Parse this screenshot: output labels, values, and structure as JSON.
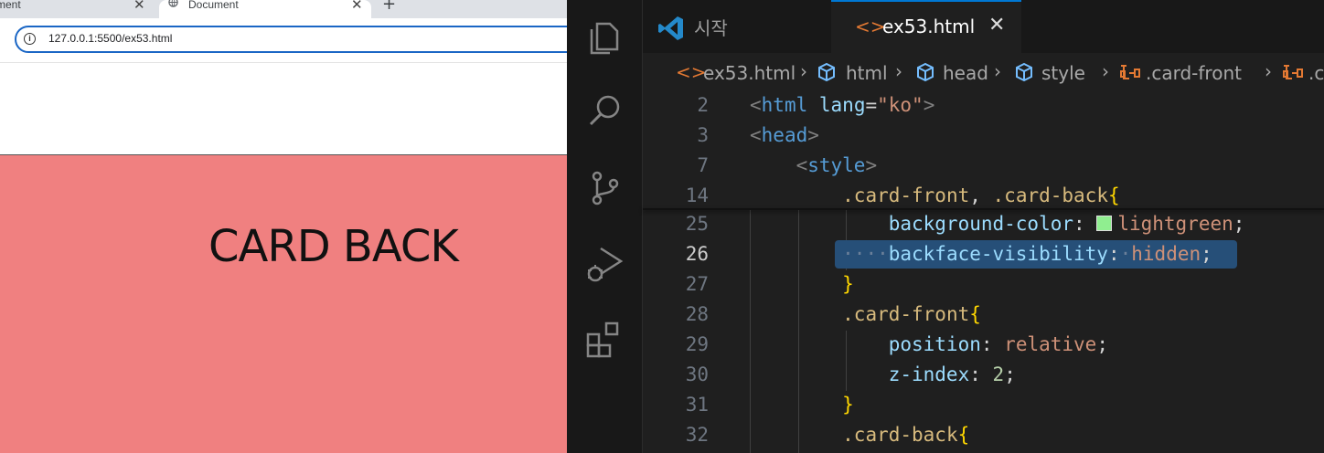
{
  "browser": {
    "tabs": [
      {
        "label": "ment",
        "active": false
      },
      {
        "label": "Document",
        "active": true
      }
    ],
    "new_tab_symbol": "+",
    "close_symbol": "✕",
    "url": "127.0.0.1:5500/ex53.html",
    "info_symbol": "i",
    "page": {
      "card_text": "CARD BACK",
      "card_color": "#f08080"
    }
  },
  "editor": {
    "tabs": [
      {
        "label": "시작",
        "icon": "vscode-logo-icon",
        "active": false
      },
      {
        "label": "ex53.html",
        "icon": "html-code-icon",
        "active": true,
        "close": "✕"
      }
    ],
    "breadcrumbs": {
      "file": "ex53.html",
      "items": [
        "html",
        "head",
        "style",
        ".card-front",
        ".card"
      ]
    },
    "active_line": "26",
    "lines": [
      {
        "n": "2",
        "parts": [
          [
            "c-tag",
            "<"
          ],
          [
            "c-name",
            "html"
          ],
          [
            "c-punc",
            " "
          ],
          [
            "c-attr",
            "lang"
          ],
          [
            "c-eq",
            "="
          ],
          [
            "c-str",
            "\"ko\""
          ],
          [
            "c-tag",
            ">"
          ]
        ],
        "indent": 0
      },
      {
        "n": "3",
        "parts": [
          [
            "c-tag",
            "<"
          ],
          [
            "c-name",
            "head"
          ],
          [
            "c-tag",
            ">"
          ]
        ],
        "indent": 0
      },
      {
        "n": "7",
        "parts": [
          [
            "c-punc",
            "    "
          ],
          [
            "c-tag",
            "<"
          ],
          [
            "c-name",
            "style"
          ],
          [
            "c-tag",
            ">"
          ]
        ],
        "indent": 0
      },
      {
        "n": "14",
        "parts": [
          [
            "c-punc",
            "        "
          ],
          [
            "c-sel",
            ".card-front"
          ],
          [
            "c-punc",
            ", "
          ],
          [
            "c-sel",
            ".card-back"
          ],
          [
            "c-brace",
            "{"
          ]
        ],
        "indent": 0
      },
      {
        "n": "25",
        "parts": [
          [
            "c-punc",
            "            "
          ],
          [
            "c-prop",
            "background-color"
          ],
          [
            "c-punc",
            ": "
          ],
          [
            "swatch",
            ""
          ],
          [
            "c-val",
            "lightgreen"
          ],
          [
            "c-punc",
            ";"
          ]
        ],
        "indent": 0
      },
      {
        "n": "26",
        "parts": [
          [
            "c-punc",
            "        "
          ],
          [
            "c-dot",
            "····"
          ],
          [
            "c-prop",
            "backface-visibility"
          ],
          [
            "c-punc",
            ":"
          ],
          [
            "c-dot",
            "·"
          ],
          [
            "c-val",
            "hidden"
          ],
          [
            "c-punc",
            ";"
          ]
        ],
        "indent": 0
      },
      {
        "n": "27",
        "parts": [
          [
            "c-punc",
            "        "
          ],
          [
            "c-brace",
            "}"
          ]
        ],
        "indent": 0
      },
      {
        "n": "28",
        "parts": [
          [
            "c-punc",
            "        "
          ],
          [
            "c-sel",
            ".card-front"
          ],
          [
            "c-brace",
            "{"
          ]
        ],
        "indent": 0
      },
      {
        "n": "29",
        "parts": [
          [
            "c-punc",
            "            "
          ],
          [
            "c-prop",
            "position"
          ],
          [
            "c-punc",
            ": "
          ],
          [
            "c-val",
            "relative"
          ],
          [
            "c-punc",
            ";"
          ]
        ],
        "indent": 0
      },
      {
        "n": "30",
        "parts": [
          [
            "c-punc",
            "            "
          ],
          [
            "c-prop",
            "z-index"
          ],
          [
            "c-punc",
            ": "
          ],
          [
            "c-num",
            "2"
          ],
          [
            "c-punc",
            ";"
          ]
        ],
        "indent": 0
      },
      {
        "n": "31",
        "parts": [
          [
            "c-punc",
            "        "
          ],
          [
            "c-brace",
            "}"
          ]
        ],
        "indent": 0
      },
      {
        "n": "32",
        "parts": [
          [
            "c-punc",
            "        "
          ],
          [
            "c-sel",
            ".card-back"
          ],
          [
            "c-brace",
            "{"
          ]
        ],
        "indent": 0
      }
    ]
  },
  "activity_bar": [
    "explorer-icon",
    "search-icon",
    "source-control-icon",
    "run-debug-icon",
    "extensions-icon"
  ]
}
